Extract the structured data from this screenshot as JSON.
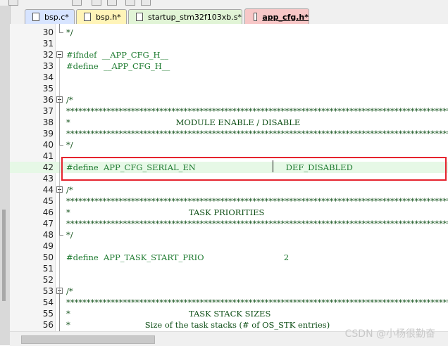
{
  "tabs": [
    {
      "label": "bsp.c*",
      "color": "#d7e4ff",
      "left": 0
    },
    {
      "label": "bsp.h*",
      "color": "#fff4b8",
      "left": 0
    },
    {
      "label": "startup_stm32f103xb.s*",
      "color": "#e1f4d6",
      "left": 0
    },
    {
      "label": "app_cfg.h*",
      "color": "#f7c7c7",
      "left": 0,
      "active": true
    }
  ],
  "lines": [
    {
      "n": "30",
      "code": "*/",
      "kind": "comment"
    },
    {
      "n": "31",
      "code": "",
      "kind": "blank"
    },
    {
      "n": "32",
      "code": "#ifndef  __APP_CFG_H__",
      "kind": "directive",
      "fold": true
    },
    {
      "n": "33",
      "code": "#define  __APP_CFG_H__",
      "kind": "directive"
    },
    {
      "n": "34",
      "code": "",
      "kind": "blank"
    },
    {
      "n": "35",
      "code": "",
      "kind": "blank"
    },
    {
      "n": "36",
      "code": "/*",
      "kind": "comment",
      "fold": true
    },
    {
      "n": "37",
      "code": "*********************************************************************************************************",
      "kind": "comment"
    },
    {
      "n": "38",
      "code": "*                                         MODULE ENABLE / DISABLE",
      "kind": "comment"
    },
    {
      "n": "39",
      "code": "*********************************************************************************************************",
      "kind": "comment"
    },
    {
      "n": "40",
      "code": "*/",
      "kind": "comment"
    },
    {
      "n": "41",
      "code": "",
      "kind": "blank"
    },
    {
      "n": "42",
      "code": "#define  APP_CFG_SERIAL_EN                                   DEF_DISABLED",
      "kind": "directive",
      "highlight": true,
      "caret": true
    },
    {
      "n": "43",
      "code": "",
      "kind": "blank"
    },
    {
      "n": "44",
      "code": "/*",
      "kind": "comment",
      "fold": true
    },
    {
      "n": "45",
      "code": "*********************************************************************************************************",
      "kind": "comment"
    },
    {
      "n": "46",
      "code": "*                                              TASK PRIORITIES",
      "kind": "comment"
    },
    {
      "n": "47",
      "code": "*********************************************************************************************************",
      "kind": "comment"
    },
    {
      "n": "48",
      "code": "*/",
      "kind": "comment"
    },
    {
      "n": "49",
      "code": "",
      "kind": "blank"
    },
    {
      "n": "50",
      "code": "#define  APP_TASK_START_PRIO                               2",
      "kind": "directive"
    },
    {
      "n": "51",
      "code": "",
      "kind": "blank"
    },
    {
      "n": "52",
      "code": "",
      "kind": "blank"
    },
    {
      "n": "53",
      "code": "/*",
      "kind": "comment",
      "fold": true
    },
    {
      "n": "54",
      "code": "*********************************************************************************************************",
      "kind": "comment"
    },
    {
      "n": "55",
      "code": "*                                              TASK STACK SIZES",
      "kind": "comment"
    },
    {
      "n": "56",
      "code": "*                             Size of the task stacks (# of OS_STK entries)",
      "kind": "comment"
    }
  ],
  "watermark": "CSDN @小杨很勤奋"
}
